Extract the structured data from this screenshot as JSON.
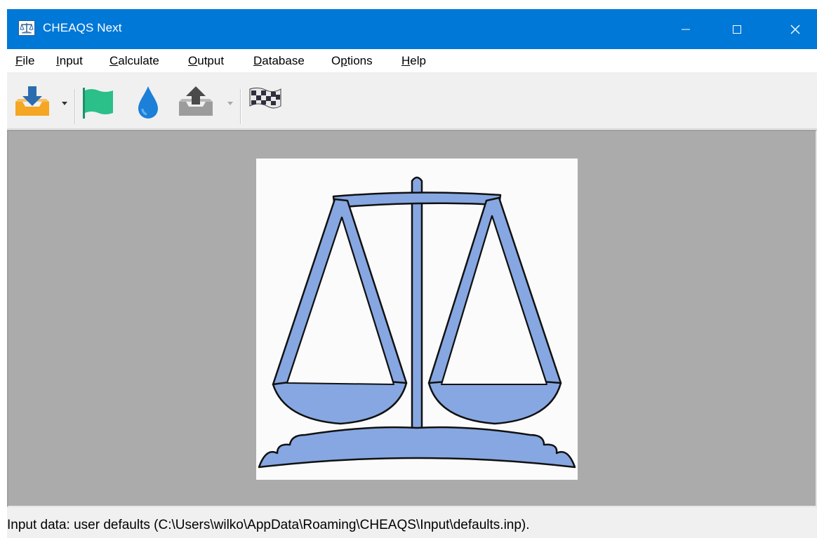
{
  "window": {
    "title": "CHEAQS Next",
    "controls": {
      "minimize_icon": "minimize-icon",
      "maximize_icon": "maximize-icon",
      "close_icon": "close-icon"
    }
  },
  "menu": {
    "items": [
      {
        "label": "File",
        "accel": "F",
        "rest": "ile"
      },
      {
        "label": "Input",
        "accel": "I",
        "rest": "nput"
      },
      {
        "label": "Calculate",
        "accel": "C",
        "rest": "alculate"
      },
      {
        "label": "Output",
        "accel": "O",
        "rest": "utput"
      },
      {
        "label": "Database",
        "accel": "D",
        "rest": "atabase"
      },
      {
        "label": "Options",
        "accel": "p",
        "pre": "O",
        "rest": "tions"
      },
      {
        "label": "Help",
        "accel": "H",
        "rest": "elp"
      }
    ]
  },
  "toolbar": {
    "buttons": [
      {
        "icon": "import-tray-icon",
        "has_dropdown": true,
        "enabled": true
      },
      {
        "icon": "green-flag-icon",
        "has_dropdown": false,
        "enabled": true
      },
      {
        "icon": "water-drop-icon",
        "has_dropdown": false,
        "enabled": true
      },
      {
        "icon": "export-tray-icon",
        "has_dropdown": true,
        "enabled": false
      },
      {
        "icon": "checkered-flag-icon",
        "has_dropdown": false,
        "enabled": true
      }
    ]
  },
  "workspace": {
    "logo": "scales-of-balance-logo",
    "colors": {
      "background": "#ababab",
      "logo_fill": "#86a7e1",
      "logo_outline": "#111111"
    }
  },
  "status": {
    "text": "Input data: user defaults (C:\\Users\\wilko\\AppData\\Roaming\\CHEAQS\\Input\\defaults.inp)."
  },
  "colors": {
    "titlebar": "#0078d7",
    "accent_orange": "#f5a623",
    "flag_green": "#2bbf8a",
    "drop_blue": "#1c7fd8"
  }
}
